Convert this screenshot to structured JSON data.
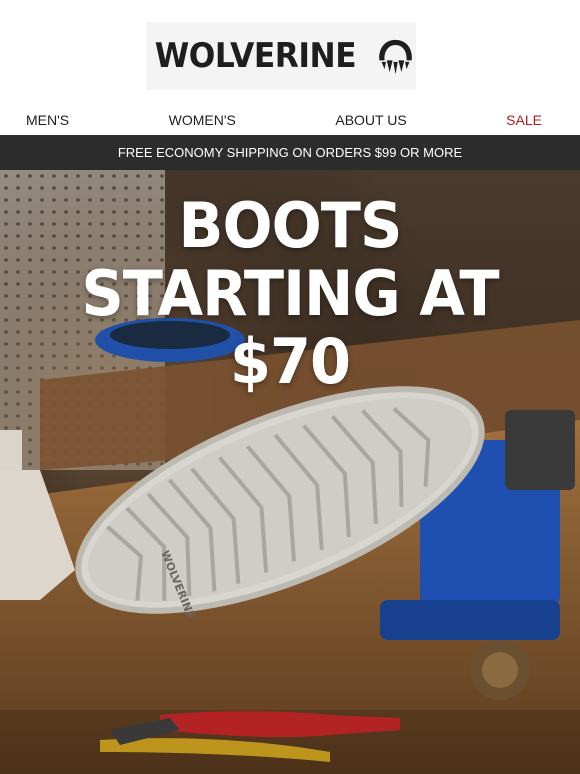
{
  "brand": {
    "name": "WOLVERINE"
  },
  "nav": {
    "items": [
      "MEN'S",
      "WOMEN'S",
      "ABOUT US",
      "SALE"
    ]
  },
  "promo": {
    "text": "FREE ECONOMY SHIPPING ON ORDERS $99 OR MORE"
  },
  "hero": {
    "line1": "BOOTS",
    "line2": "STARTING AT",
    "line3": "$70",
    "sole_brand": "WOLVERINE"
  },
  "colors": {
    "sale": "#b51e1e",
    "promo_bg": "#2c2c2c",
    "vise": "#1f4fb0",
    "pliers": "#d42a2a"
  }
}
